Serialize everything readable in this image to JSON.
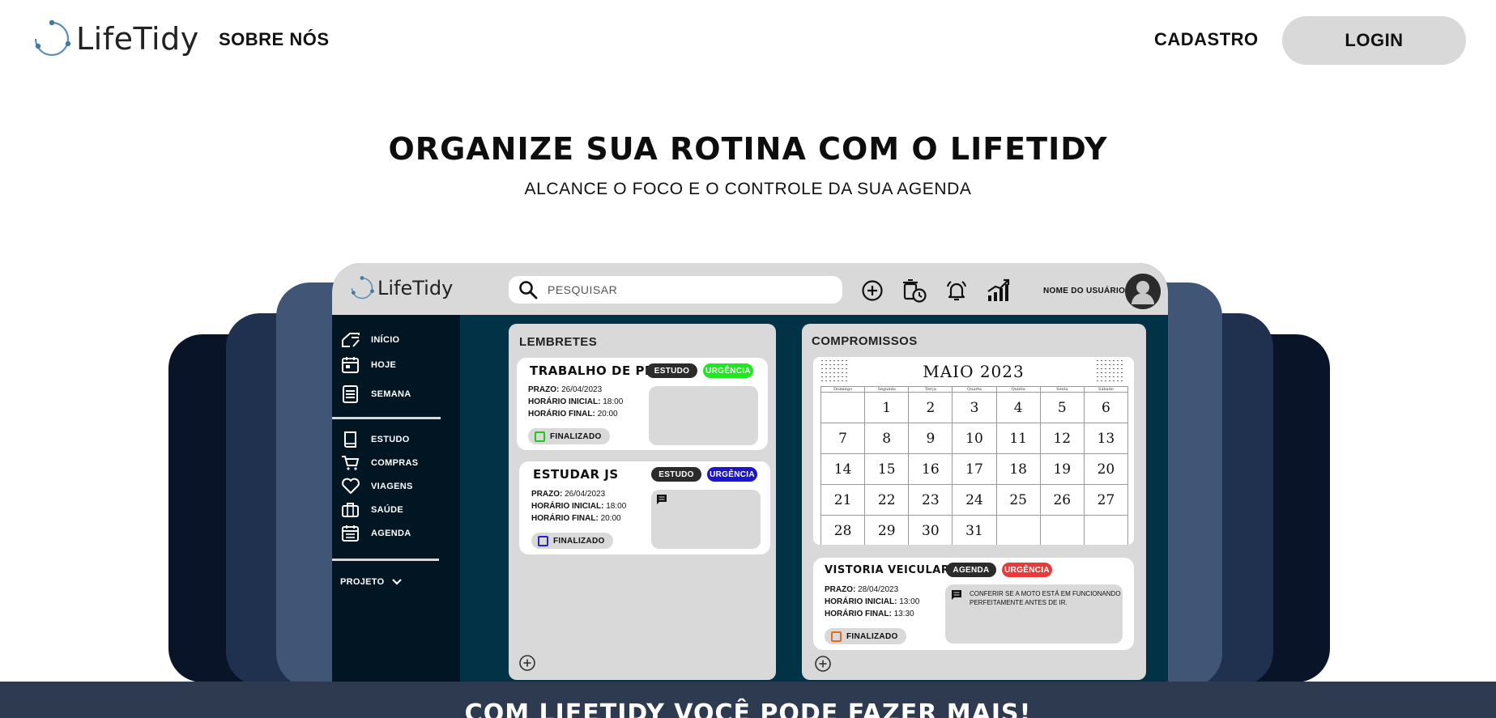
{
  "nav": {
    "brand": "LifeTidy",
    "about_label": "SOBRE NÓS",
    "signup_label": "CADASTRO",
    "login_label": "LOGIN"
  },
  "hero": {
    "title": "ORGANIZE SUA ROTINA COM O LIFETIDY",
    "subtitle": "ALCANCE O FOCO E O CONTROLE DA SUA AGENDA"
  },
  "app": {
    "brand": "LifeTidy",
    "search_placeholder": "PESQUISAR",
    "toolbar_icons": [
      "add-circle-icon",
      "trash-clock-icon",
      "alarm-bell-icon",
      "growth-chart-icon"
    ],
    "user_name": "NOME DO USUÁRIO",
    "sidebar": {
      "items": [
        {
          "label": "INÍCIO",
          "icon": "home-icon"
        },
        {
          "label": "HOJE",
          "icon": "calendar-today-icon"
        },
        {
          "label": "SEMANA",
          "icon": "week-calendar-icon"
        },
        {
          "label": "ESTUDO",
          "icon": "book-icon"
        },
        {
          "label": "COMPRAS",
          "icon": "cart-icon"
        },
        {
          "label": "VIAGENS",
          "icon": "heart-icon"
        },
        {
          "label": "SAÚDE",
          "icon": "briefcase-icon"
        },
        {
          "label": "AGENDA",
          "icon": "agenda-icon"
        }
      ],
      "project_label": "PROJETO"
    },
    "reminders": {
      "title": "LEMBRETES",
      "tasks": [
        {
          "title": "TRABALHO DE PI",
          "category": "ESTUDO",
          "urgency": "URGÊNCIA",
          "urgency_color": "#1ee81e",
          "deadline_label": "PRAZO:",
          "deadline": "26/04/2023",
          "start_label": "HORÁRIO INICIAL:",
          "start": "18:00",
          "end_label": "HORÁRIO FINAL:",
          "end": "20:00",
          "done_label": "FINALIZADO",
          "box_color": "#1ec81e"
        },
        {
          "title": "ESTUDAR JS",
          "category": "ESTUDO",
          "urgency": "URGÊNCIA",
          "urgency_color": "#1c16c8",
          "deadline_label": "PRAZO:",
          "deadline": "26/04/2023",
          "start_label": "HORÁRIO INICIAL:",
          "start": "18:00",
          "end_label": "HORÁRIO FINAL:",
          "end": "20:00",
          "done_label": "FINALIZADO",
          "box_color": "#2a22c8"
        }
      ]
    },
    "appointments": {
      "title": "COMPROMISSOS",
      "calendar": {
        "month": "MAIO 2023",
        "weekdays": [
          "Domingo",
          "Segunda",
          "Terça",
          "Quarta",
          "Quinta",
          "Sexta",
          "Sábado"
        ],
        "weeks": [
          [
            "",
            "1",
            "2",
            "3",
            "4",
            "5",
            "6"
          ],
          [
            "7",
            "8",
            "9",
            "10",
            "11",
            "12",
            "13"
          ],
          [
            "14",
            "15",
            "16",
            "17",
            "18",
            "19",
            "20"
          ],
          [
            "21",
            "22",
            "23",
            "24",
            "25",
            "26",
            "27"
          ],
          [
            "28",
            "29",
            "30",
            "31",
            "",
            "",
            ""
          ]
        ]
      },
      "task": {
        "title": "VISTORIA VEICULAR",
        "category": "AGENDA",
        "urgency": "URGÊNCIA",
        "urgency_color": "#e83a3a",
        "deadline_label": "PRAZO:",
        "deadline": "28/04/2023",
        "start_label": "HORÁRIO INICIAL:",
        "start": "13:00",
        "end_label": "HORÁRIO FINAL:",
        "end": "13:30",
        "note": "CONFERIR SE A MOTO ESTÁ EM FUNCIONANDO PERFEITAMENTE ANTES DE IR.",
        "done_label": "FINALIZADO",
        "box_color": "#e86a1e"
      }
    }
  },
  "banner": {
    "text": "COM LIFETIDY VOCÊ PODE FAZER MAIS!"
  },
  "colors": {
    "dark_navy": "#0a1428",
    "mid_navy": "#20304f",
    "slate": "#415676",
    "app_bg": "#023246",
    "sidebar_bg": "#011523",
    "panel_gray": "#d9d9d9",
    "tag_dark": "#2b2b2b"
  }
}
